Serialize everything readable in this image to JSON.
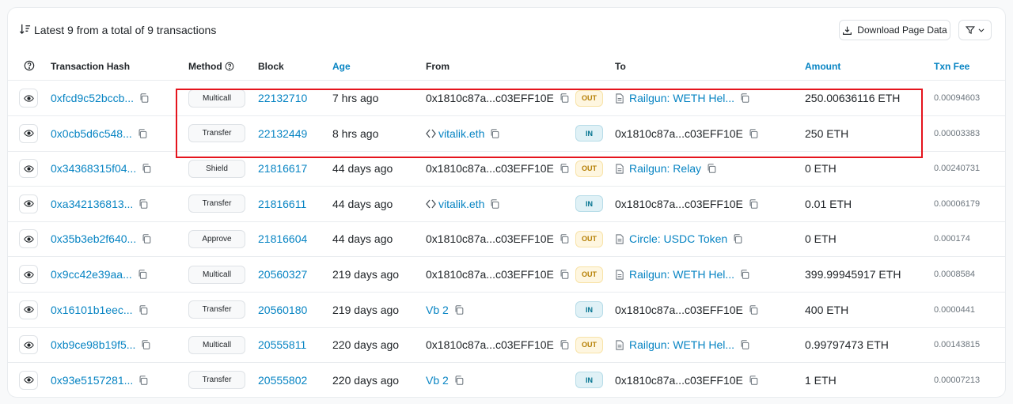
{
  "header": {
    "summary": "Latest 9 from a total of 9 transactions",
    "download_label": "Download Page Data",
    "filter_icon": "filter-icon"
  },
  "columns": {
    "hash": "Transaction Hash",
    "method": "Method",
    "block": "Block",
    "age": "Age",
    "from": "From",
    "to": "To",
    "amount": "Amount",
    "fee": "Txn Fee"
  },
  "rows": [
    {
      "hash": "0xfcd9c52bccb...",
      "method": "Multicall",
      "block": "22132710",
      "age": "7 hrs ago",
      "from": "0x1810c87a...c03EFF10E",
      "from_type": "plain",
      "dir": "OUT",
      "to": "Railgun: WETH Hel...",
      "to_type": "contract",
      "amount": "250.00636116 ETH",
      "fee": "0.00094603"
    },
    {
      "hash": "0x0cb5d6c548...",
      "method": "Transfer",
      "block": "22132449",
      "age": "8 hrs ago",
      "from": "vitalik.eth",
      "from_type": "ens",
      "dir": "IN",
      "to": "0x1810c87a...c03EFF10E",
      "to_type": "plain",
      "amount": "250 ETH",
      "fee": "0.00003383"
    },
    {
      "hash": "0x34368315f04...",
      "method": "Shield",
      "block": "21816617",
      "age": "44 days ago",
      "from": "0x1810c87a...c03EFF10E",
      "from_type": "plain",
      "dir": "OUT",
      "to": "Railgun: Relay",
      "to_type": "contract",
      "amount": "0 ETH",
      "fee": "0.00240731"
    },
    {
      "hash": "0xa342136813...",
      "method": "Transfer",
      "block": "21816611",
      "age": "44 days ago",
      "from": "vitalik.eth",
      "from_type": "ens",
      "dir": "IN",
      "to": "0x1810c87a...c03EFF10E",
      "to_type": "plain",
      "amount": "0.01 ETH",
      "fee": "0.00006179"
    },
    {
      "hash": "0x35b3eb2f640...",
      "method": "Approve",
      "block": "21816604",
      "age": "44 days ago",
      "from": "0x1810c87a...c03EFF10E",
      "from_type": "plain",
      "dir": "OUT",
      "to": "Circle: USDC Token",
      "to_type": "contract",
      "amount": "0 ETH",
      "fee": "0.000174"
    },
    {
      "hash": "0x9cc42e39aa...",
      "method": "Multicall",
      "block": "20560327",
      "age": "219 days ago",
      "from": "0x1810c87a...c03EFF10E",
      "from_type": "plain",
      "dir": "OUT",
      "to": "Railgun: WETH Hel...",
      "to_type": "contract",
      "amount": "399.99945917 ETH",
      "fee": "0.0008584"
    },
    {
      "hash": "0x16101b1eec...",
      "method": "Transfer",
      "block": "20560180",
      "age": "219 days ago",
      "from": "Vb 2",
      "from_type": "name",
      "dir": "IN",
      "to": "0x1810c87a...c03EFF10E",
      "to_type": "plain",
      "amount": "400 ETH",
      "fee": "0.0000441"
    },
    {
      "hash": "0xb9ce98b19f5...",
      "method": "Multicall",
      "block": "20555811",
      "age": "220 days ago",
      "from": "0x1810c87a...c03EFF10E",
      "from_type": "plain",
      "dir": "OUT",
      "to": "Railgun: WETH Hel...",
      "to_type": "contract",
      "amount": "0.99797473 ETH",
      "fee": "0.00143815"
    },
    {
      "hash": "0x93e5157281...",
      "method": "Transfer",
      "block": "20555802",
      "age": "220 days ago",
      "from": "Vb 2",
      "from_type": "name",
      "dir": "IN",
      "to": "0x1810c87a...c03EFF10E",
      "to_type": "plain",
      "amount": "1 ETH",
      "fee": "0.00007213"
    }
  ],
  "colors": {
    "link": "#0784c3",
    "highlight": "#e5141d",
    "out_badge": "#fef6e0",
    "in_badge": "#e0f1f6"
  }
}
